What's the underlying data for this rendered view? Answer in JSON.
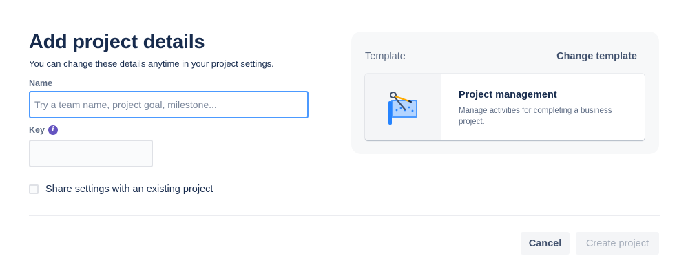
{
  "form": {
    "title": "Add project details",
    "subtitle": "You can change these details anytime in your project settings.",
    "name_label": "Name",
    "name_placeholder": "Try a team name, project goal, milestone...",
    "name_value": "",
    "key_label": "Key",
    "key_value": "",
    "info_icon": "info-icon",
    "share_label": "Share settings with an existing project",
    "share_checked": false
  },
  "template": {
    "label": "Template",
    "change_label": "Change template",
    "card": {
      "title": "Project management",
      "description": "Manage activities for completing a business project.",
      "icon": "project-management-illustration"
    }
  },
  "footer": {
    "cancel_label": "Cancel",
    "create_label": "Create project"
  },
  "colors": {
    "primary_text": "#172b4d",
    "secondary_text": "#5e6c84",
    "focus_border": "#4c9aff",
    "info_purple": "#6554c0",
    "disabled_text": "#a5adba"
  }
}
